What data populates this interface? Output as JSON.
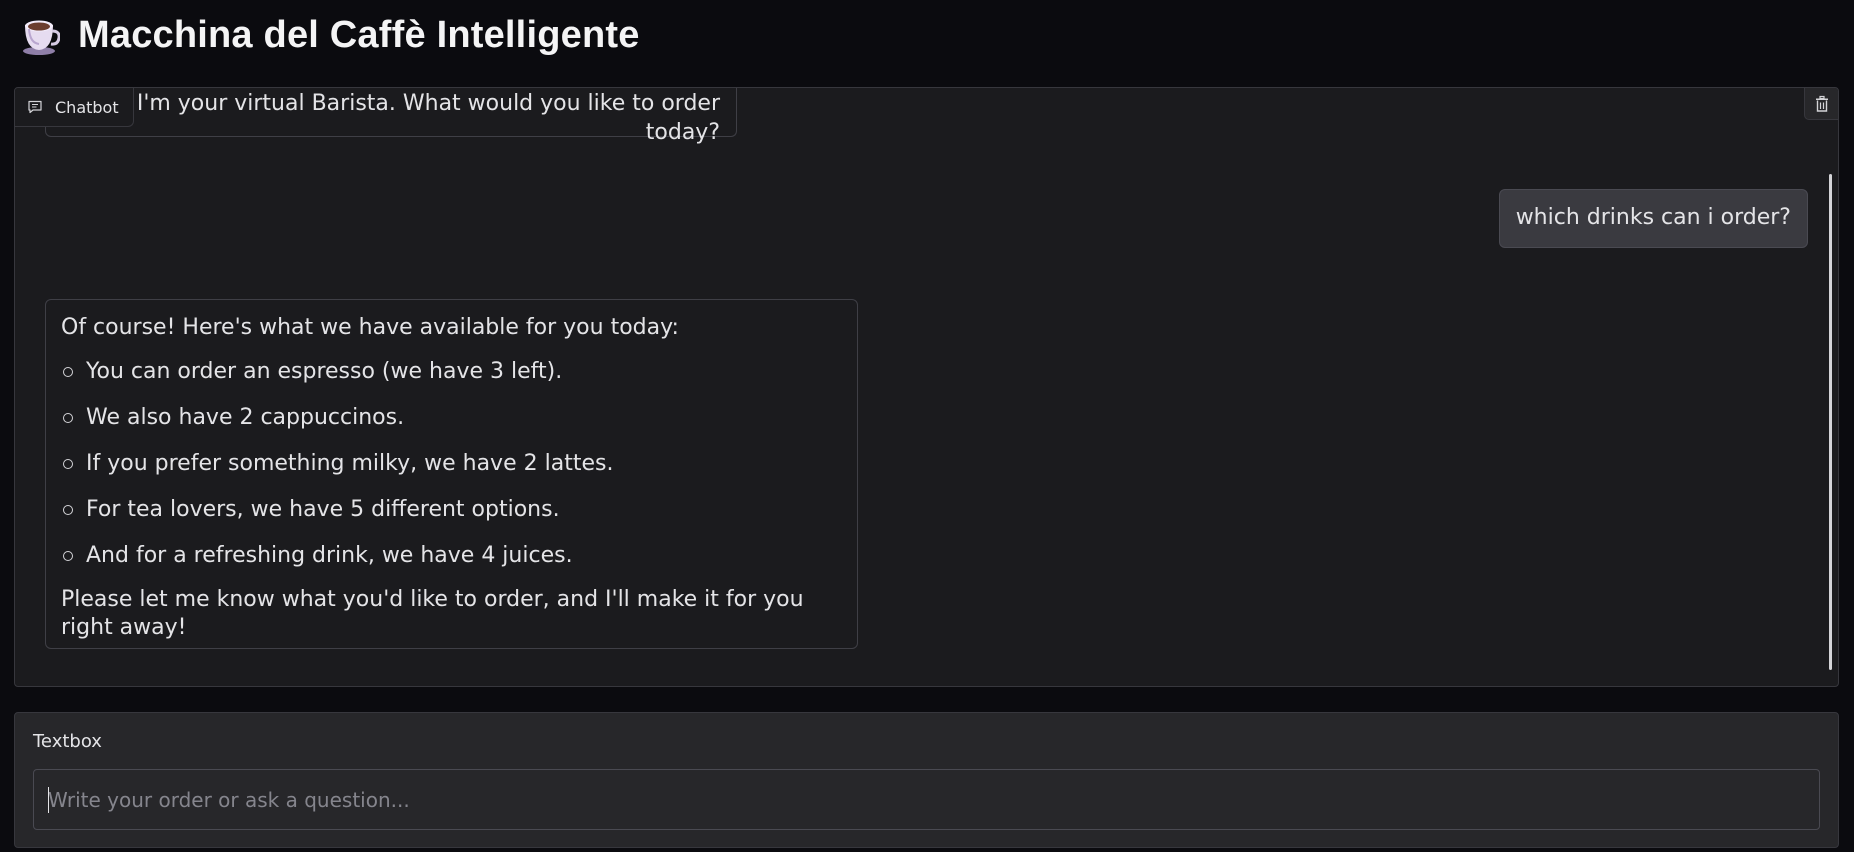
{
  "header": {
    "title": "Macchina del Caffè Intelligente",
    "logo_icon": "coffee-cup-icon"
  },
  "chatbot": {
    "label": "Chatbot",
    "label_icon": "chat-bubble-icon",
    "clear_icon": "trash-icon",
    "messages": [
      {
        "role": "assistant",
        "text": "I'm your virtual Barista. What would you like to order today?"
      },
      {
        "role": "user",
        "text": "which drinks can i order?"
      },
      {
        "role": "assistant",
        "intro": "Of course! Here's what we have available for you today:",
        "items": [
          "You can order an espresso (we have 3 left).",
          "We also have 2 cappuccinos.",
          "If you prefer something milky, we have 2 lattes.",
          "For tea lovers, we have 5 different options.",
          "And for a refreshing drink, we have 4 juices."
        ],
        "outro": "Please let me know what you'd like to order, and I'll make it for you right away!"
      }
    ]
  },
  "textbox": {
    "label": "Textbox",
    "value": "",
    "placeholder": "Write your order or ask a question..."
  },
  "colors": {
    "background": "#0b0b0f",
    "panel": "#1b1b1e",
    "user_bubble": "#3a3a40",
    "border": "#37373d"
  }
}
